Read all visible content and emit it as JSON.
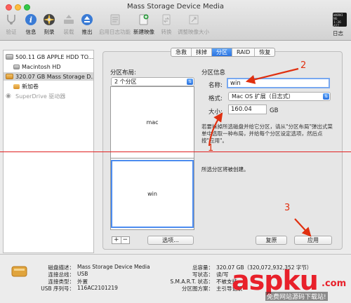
{
  "window": {
    "title": "Mass Storage Device Media"
  },
  "toolbar": [
    {
      "label": "验证",
      "icon": "stethoscope-icon",
      "enabled": false
    },
    {
      "label": "信息",
      "icon": "info-icon",
      "enabled": true
    },
    {
      "label": "刻录",
      "icon": "burn-icon",
      "enabled": true
    },
    {
      "label": "装载",
      "icon": "mount-icon",
      "enabled": false
    },
    {
      "label": "推出",
      "icon": "eject-icon",
      "enabled": true
    },
    {
      "label": "启用日志功能",
      "icon": "journal-icon",
      "enabled": false
    },
    {
      "label": "新建映像",
      "icon": "new-image-icon",
      "enabled": true
    },
    {
      "label": "转换",
      "icon": "convert-icon",
      "enabled": false
    },
    {
      "label": "调整映像大小",
      "icon": "resize-icon",
      "enabled": false
    }
  ],
  "log": {
    "label": "日志",
    "box_text": "WARNI\nNG 1:36\nAY7 BM6"
  },
  "sidebar": {
    "items": [
      {
        "label": "500.11 GB APPLE HDD TO...",
        "type": "hd",
        "indent": 0,
        "selected": false
      },
      {
        "label": "Macintosh HD",
        "type": "vol",
        "indent": 1,
        "selected": false
      },
      {
        "label": "320.07 GB Mass Storage D...",
        "type": "ext",
        "indent": 0,
        "selected": true
      },
      {
        "label": "新加卷",
        "type": "vol",
        "indent": 1,
        "selected": false
      },
      {
        "label": "SuperDrive 驱动器",
        "type": "net",
        "indent": 0,
        "selected": false
      }
    ]
  },
  "tabs": [
    {
      "label": "急救",
      "active": false
    },
    {
      "label": "抹掉",
      "active": false
    },
    {
      "label": "分区",
      "active": true
    },
    {
      "label": "RAID",
      "active": false
    },
    {
      "label": "恢复",
      "active": false
    }
  ],
  "layout": {
    "title": "分区布局:",
    "scheme": "2 个分区",
    "partitions": [
      "mac",
      "win"
    ],
    "options_button": "选项..."
  },
  "info": {
    "title": "分区信息",
    "name_label": "名称:",
    "name_value": "win",
    "format_label": "格式:",
    "format_value": "Mac OS 扩展（日志式）",
    "size_label": "大小:",
    "size_value": "160.04",
    "size_unit": "GB",
    "description": "若要抹掉所选磁盘并给它分区，请从\"分区布局\"弹出式菜单中选取一种布局，并给每个分区设定选项，然后点按\"应用\"。",
    "status": "所选分区将被创建。"
  },
  "buttons": {
    "revert": "复原",
    "apply": "应用"
  },
  "footer": {
    "left": [
      {
        "key": "磁盘描述：",
        "value": "Mass Storage Device Media"
      },
      {
        "key": "连接总线：",
        "value": "USB"
      },
      {
        "key": "连接类型：",
        "value": "外置"
      },
      {
        "key": "USB 序列号：",
        "value": "116AC2101219"
      }
    ],
    "right": [
      {
        "key": "总容量：",
        "value": "320.07 GB（320,072,932,352 字节）"
      },
      {
        "key": "写状态：",
        "value": "读/写"
      },
      {
        "key": "S.M.A.R.T. 状态：",
        "value": "不被支持"
      },
      {
        "key": "分区图方案：",
        "value": "主引导记录"
      }
    ]
  },
  "annotations": [
    "1",
    "2",
    "3"
  ],
  "watermark": {
    "brand": "aspku",
    "tld": ".com",
    "caption": "免费网站源码下载站!"
  }
}
